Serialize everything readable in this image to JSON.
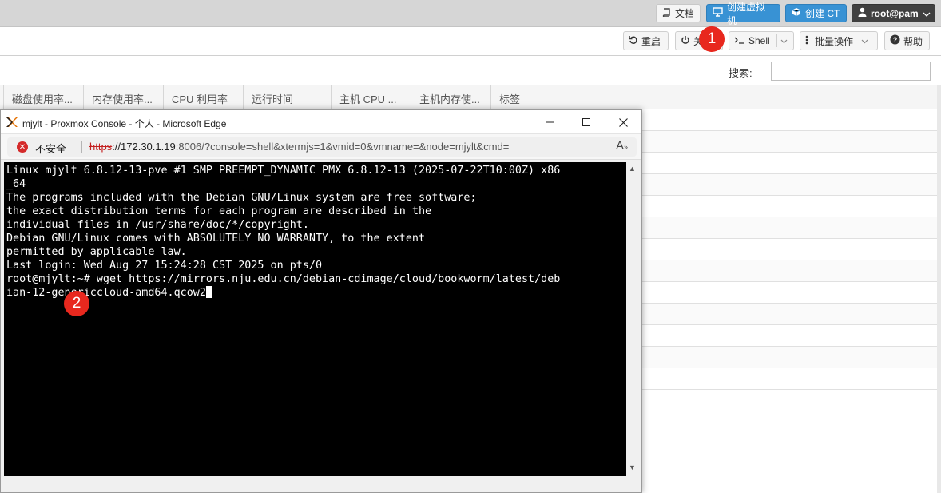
{
  "topbar": {
    "docs_label": "文档",
    "create_vm_label": "创建虚拟机",
    "create_ct_label": "创建 CT",
    "user_label": "root@pam"
  },
  "toolbar": {
    "restart_label": "重启",
    "shutdown_label": "关",
    "shell_label": "Shell",
    "bulk_label": "批量操作",
    "help_label": "帮助"
  },
  "search": {
    "label": "搜索:",
    "value": ""
  },
  "grid": {
    "columns": [
      "磁盘使用率...",
      "内存使用率...",
      "CPU 利用率",
      "运行时间",
      "",
      "主机 CPU ...",
      "主机内存使...",
      "标签"
    ]
  },
  "console_window": {
    "title": "mjylt - Proxmox Console - 个人 - Microsoft Edge",
    "insecure_label": "不安全",
    "url_scheme": "https",
    "url_host": "://172.30.1.19",
    "url_rest": ":8006/?console=shell&xtermjs=1&vmid=0&vmname=&node=mjylt&cmd=",
    "terminal_lines": [
      "Linux mjylt 6.8.12-13-pve #1 SMP PREEMPT_DYNAMIC PMX 6.8.12-13 (2025-07-22T10:00Z) x86",
      "_64",
      "",
      "The programs included with the Debian GNU/Linux system are free software;",
      "the exact distribution terms for each program are described in the",
      "individual files in /usr/share/doc/*/copyright.",
      "",
      "Debian GNU/Linux comes with ABSOLUTELY NO WARRANTY, to the extent",
      "permitted by applicable law.",
      "Last login: Wed Aug 27 15:24:28 CST 2025 on pts/0",
      "root@mjylt:~# wget https://mirrors.nju.edu.cn/debian-cdimage/cloud/bookworm/latest/deb",
      "ian-12-genericcloud-amd64.qcow2"
    ]
  },
  "badges": {
    "step1": "1",
    "step2": "2"
  },
  "colors": {
    "primary_button": "#3892d4",
    "user_button": "#404040",
    "badge": "#e8281e",
    "insecure": "#d42a2a"
  }
}
